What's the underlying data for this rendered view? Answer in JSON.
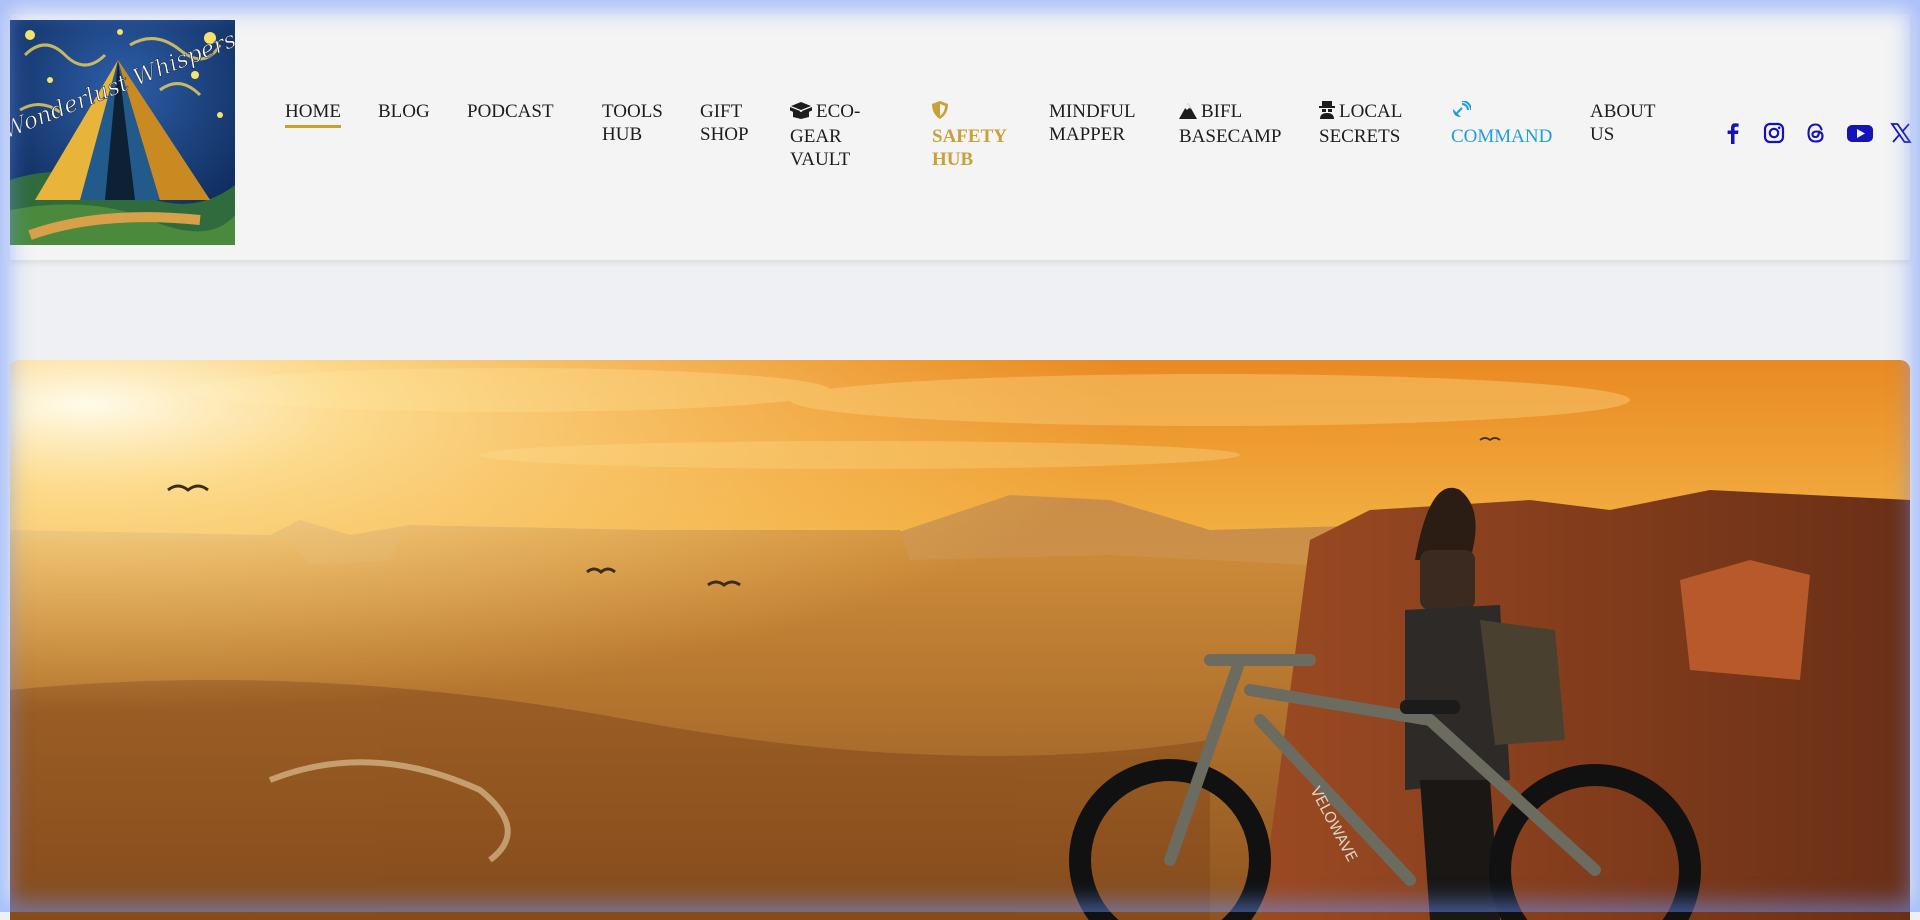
{
  "site": {
    "logo_text": "Wonderlust Whispers"
  },
  "nav": {
    "items": [
      {
        "label_lines": [
          "HOME"
        ]
      },
      {
        "label_lines": [
          "BLOG"
        ]
      },
      {
        "label_lines": [
          "PODCAST"
        ]
      },
      {
        "label_lines": [
          "TOOLS",
          "HUB"
        ]
      },
      {
        "label_lines": [
          "GIFT",
          "SHOP"
        ]
      },
      {
        "label_lines": [
          "ECO-",
          "GEAR",
          "VAULT"
        ],
        "icon": "box-open-icon"
      },
      {
        "label_lines": [
          "SAFETY",
          "HUB"
        ],
        "icon": "shield-icon"
      },
      {
        "label_lines": [
          "MINDFUL",
          "MAPPER"
        ]
      },
      {
        "label_lines": [
          "BIFL",
          "BASECAMP"
        ],
        "icon": "mountain-icon"
      },
      {
        "label_lines": [
          "LOCAL",
          "SECRETS"
        ],
        "icon": "user-secret-icon"
      },
      {
        "label_lines": [
          "COMMAND"
        ],
        "icon": "satellite-dish-icon"
      },
      {
        "label_lines": [
          "ABOUT",
          "US"
        ]
      }
    ],
    "active": "HOME"
  },
  "social": {
    "icons": [
      "facebook-icon",
      "instagram-icon",
      "threads-icon",
      "youtube-icon",
      "x-icon"
    ],
    "color": "#1313b8"
  },
  "hero": {
    "bike_brand": "VELOWAVE"
  },
  "colors": {
    "accent_gold": "#c8a133",
    "command_blue": "#1e9fd6",
    "header_bg": "#f4f4f4",
    "page_bg": "#eef0f3"
  }
}
